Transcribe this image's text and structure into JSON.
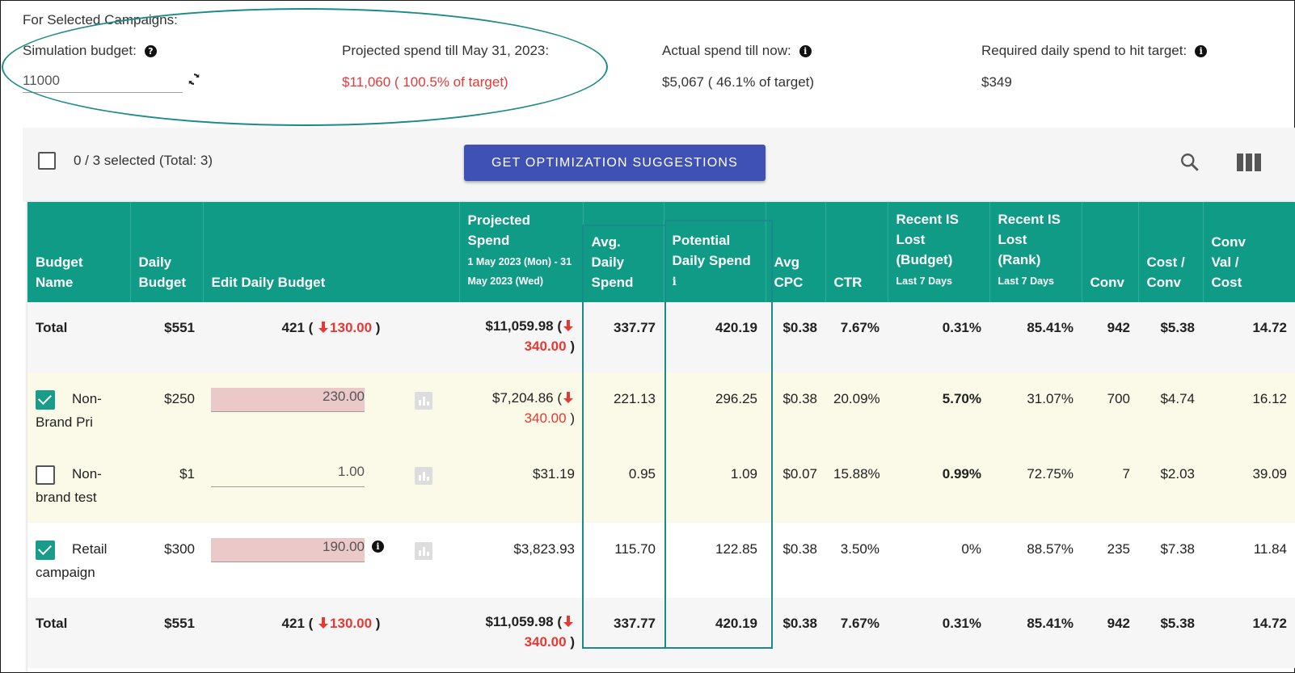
{
  "summary": {
    "heading": "For Selected Campaigns:",
    "simulation_budget_label": "Simulation budget:",
    "simulation_budget_value": "11000",
    "projected_label": "Projected spend till May 31, 2023:",
    "projected_value": "$11,060 ( 100.5% of target)",
    "actual_label": "Actual spend till now:",
    "actual_value": "$5,067 ( 46.1% of target)",
    "required_label": "Required daily spend to hit target:",
    "required_value": "$349"
  },
  "toolbar": {
    "selected_text": "0 / 3 selected (Total: 3)",
    "optimize_button": "GET OPTIMIZATION SUGGESTIONS"
  },
  "headers": {
    "budget_name_1": "Budget",
    "budget_name_2": "Name",
    "daily_budget_1": "Daily",
    "daily_budget_2": "Budget",
    "edit_daily_budget": "Edit Daily Budget",
    "projected_1": "Projected Spend",
    "projected_sub_1": "1 May 2023 (Mon) - 31",
    "projected_sub_2": "May 2023 (Wed)",
    "avg_daily_1": "Avg. Daily",
    "avg_daily_2": "Spend",
    "potential_1": "Potential",
    "potential_2": "Daily Spend",
    "avg_cpc_1": "Avg",
    "avg_cpc_2": "CPC",
    "ctr": "CTR",
    "is_budget_1": "Recent IS",
    "is_budget_2": "Lost",
    "is_budget_3": "(Budget)",
    "is_budget_sub": "Last 7 Days",
    "is_rank_1": "Recent IS",
    "is_rank_2": "Lost (Rank)",
    "is_rank_sub": "Last 7 Days",
    "conv": "Conv",
    "cost_conv_1": "Cost /",
    "cost_conv_2": "Conv",
    "conv_val_1": "Conv",
    "conv_val_2": "Val /",
    "conv_val_3": "Cost"
  },
  "totals": {
    "name": "Total",
    "daily_budget": "$551",
    "edit_value": "421 (",
    "edit_delta": "130.00",
    "edit_close": ")",
    "projected_value": "$11,059.98  (",
    "projected_delta": "340.00",
    "projected_close": ")",
    "avg_daily": "337.77",
    "potential": "420.19",
    "avg_cpc": "$0.38",
    "ctr": "7.67%",
    "is_budget": "0.31%",
    "is_rank": "85.41%",
    "conv": "942",
    "cost_conv": "$5.38",
    "conv_val": "14.72"
  },
  "rows": [
    {
      "name_1": "Non-",
      "name_2": "Brand Pri",
      "checked": true,
      "daily_budget": "$250",
      "edit": "230.00",
      "projected_value": "$7,204.86  (",
      "projected_delta": "340.00",
      "projected_close": ")",
      "avg_daily": "221.13",
      "potential": "296.25",
      "avg_cpc": "$0.38",
      "ctr": "20.09%",
      "is_budget": "5.70%",
      "is_rank": "31.07%",
      "conv": "700",
      "cost_conv": "$4.74",
      "conv_val": "16.12"
    },
    {
      "name_1": "Non-",
      "name_2": "brand test",
      "checked": false,
      "daily_budget": "$1",
      "edit": "1.00",
      "projected_value": "$31.19",
      "avg_daily": "0.95",
      "potential": "1.09",
      "avg_cpc": "$0.07",
      "ctr": "15.88%",
      "is_budget": "0.99%",
      "is_rank": "72.75%",
      "conv": "7",
      "cost_conv": "$2.03",
      "conv_val": "39.09"
    },
    {
      "name_1": "Retail",
      "name_2": "campaign",
      "checked": true,
      "daily_budget": "$300",
      "edit": "190.00",
      "projected_value": "$3,823.93",
      "avg_daily": "115.70",
      "potential": "122.85",
      "avg_cpc": "$0.38",
      "ctr": "3.50%",
      "is_budget": "0%",
      "is_rank": "88.57%",
      "conv": "235",
      "cost_conv": "$7.38",
      "conv_val": "11.84"
    }
  ],
  "colors": {
    "header_bg": "#109b86",
    "button_bg": "#3f51b5",
    "negative": "#e53935",
    "annotation": "#1b8a8a",
    "changed_input": "#ecc9c9",
    "row_highlight": "#fbfae8"
  }
}
